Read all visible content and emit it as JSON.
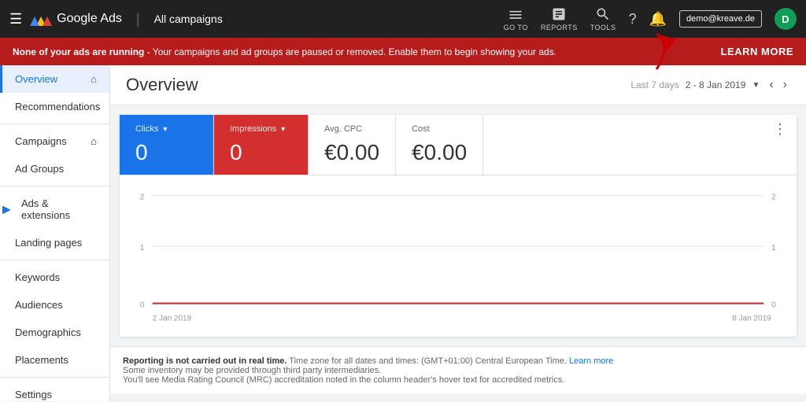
{
  "topNav": {
    "hamburger": "≡",
    "appName": "Google Ads",
    "divider": "|",
    "pageTitle": "All campaigns",
    "goTo": "GO TO",
    "reports": "REPORTS",
    "tools": "TOOLS",
    "userEmail": "demo@kreave.de",
    "userInitial": "D"
  },
  "alertBar": {
    "boldText": "None of your ads are running",
    "message": " - Your campaigns and ad groups are paused or removed. Enable them to begin showing your ads.",
    "learnMore": "LEARN MORE"
  },
  "sidebar": {
    "items": [
      {
        "label": "Overview",
        "active": true,
        "hasHome": true
      },
      {
        "label": "Recommendations",
        "active": false,
        "hasHome": false
      },
      {
        "label": "Campaigns",
        "active": false,
        "hasHome": true
      },
      {
        "label": "Ad Groups",
        "active": false,
        "hasHome": false
      },
      {
        "label": "Ads & extensions",
        "active": false,
        "hasArrow": true
      },
      {
        "label": "Landing pages",
        "active": false,
        "hasHome": false
      },
      {
        "label": "Keywords",
        "active": false,
        "hasHome": false
      },
      {
        "label": "Audiences",
        "active": false,
        "hasHome": false
      },
      {
        "label": "Demographics",
        "active": false,
        "hasHome": false
      },
      {
        "label": "Placements",
        "active": false,
        "hasHome": false
      },
      {
        "label": "Settings",
        "active": false,
        "hasHome": false
      }
    ]
  },
  "content": {
    "title": "Overview",
    "dateLabel": "Last 7 days",
    "dateRange": "2 - 8 Jan 2019",
    "metrics": [
      {
        "label": "Clicks",
        "value": "0",
        "type": "blue",
        "hasDropdown": true
      },
      {
        "label": "Impressions",
        "value": "0",
        "type": "red",
        "hasDropdown": true
      },
      {
        "label": "Avg. CPC",
        "value": "€0.00",
        "type": "plain"
      },
      {
        "label": "Cost",
        "value": "€0.00",
        "type": "plain"
      }
    ],
    "chart": {
      "yLabels": [
        "2",
        "1",
        "0"
      ],
      "xLabels": [
        "2 Jan 2019",
        "8 Jan 2019"
      ],
      "yRight": [
        "2",
        "1",
        "0"
      ]
    }
  },
  "footer": {
    "line1Bold": "Reporting is not carried out in real time.",
    "line1": " Time zone for all dates and times: (GMT+01:00) Central European Time. ",
    "line1Link": "Learn more",
    "line2": "Some inventory may be provided through third party intermediaries.",
    "line3": "You'll see Media Rating Council (MRC) accreditation noted in the column header's hover text for accredited metrics."
  }
}
